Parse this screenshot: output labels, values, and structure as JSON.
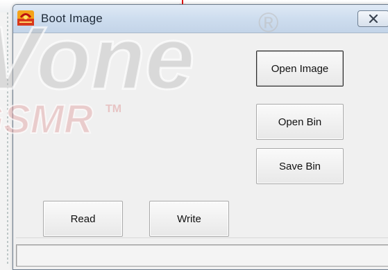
{
  "window": {
    "title": "Boot Image",
    "icon": "app-logo-icon",
    "close_icon": "close-x-icon"
  },
  "buttons": {
    "open_image": "Open Image",
    "open_bin": "Open Bin",
    "save_bin": "Save Bin",
    "read": "Read",
    "write": "Write"
  },
  "watermark": {
    "line1": "Vone",
    "registered": "®",
    "line2": "GSMR",
    "trademark": "TM"
  },
  "colors": {
    "watermark_fill": "#c9c9c9",
    "watermark_red": "#e2a6a6",
    "title_gradient_top": "#dfe9f5",
    "title_gradient_bottom": "#c3d4e8"
  }
}
